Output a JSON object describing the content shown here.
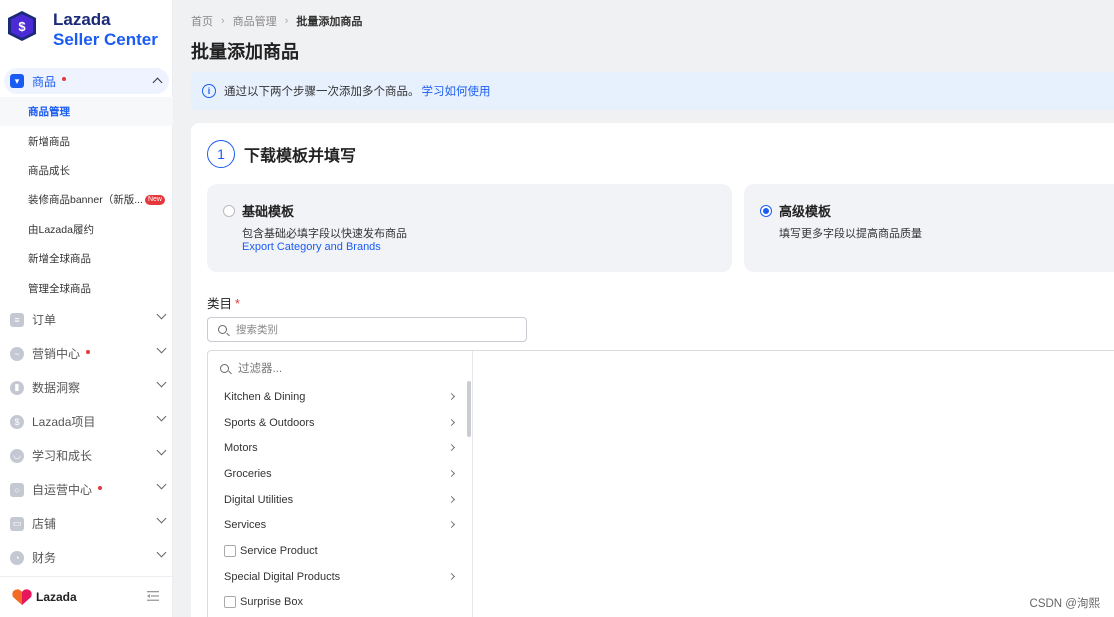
{
  "sidebar": {
    "logo": {
      "line1": "Lazada",
      "line2": "Seller Center"
    },
    "active_section": {
      "label": "商品"
    },
    "sub_items": [
      {
        "label": "商品管理"
      },
      {
        "label": "新增商品"
      },
      {
        "label": "商品成长"
      },
      {
        "label": "装修商品banner（新版...",
        "badge": "New"
      },
      {
        "label": "由Lazada履约"
      },
      {
        "label": "新增全球商品"
      },
      {
        "label": "管理全球商品"
      }
    ],
    "sections": [
      {
        "label": "订单",
        "dot": false
      },
      {
        "label": "营销中心",
        "dot": true
      },
      {
        "label": "数据洞察",
        "dot": false
      },
      {
        "label": "Lazada项目",
        "dot": false
      },
      {
        "label": "学习和成长",
        "dot": false
      },
      {
        "label": "自运营中心",
        "dot": true
      },
      {
        "label": "店铺",
        "dot": false
      },
      {
        "label": "财务",
        "dot": false
      }
    ],
    "footer_brand": "Lazada"
  },
  "breadcrumb": {
    "items": [
      "首页",
      "商品管理",
      "批量添加商品"
    ]
  },
  "page_title": "批量添加商品",
  "info": {
    "text": "通过以下两个步骤一次添加多个商品。",
    "link": "学习如何使用"
  },
  "step1": {
    "number": "1",
    "title": "下载模板并填写",
    "basic": {
      "title": "基础模板",
      "desc": "包含基础必填字段以快速发布商品",
      "link": "Export Category and Brands",
      "selected": false
    },
    "advanced": {
      "title": "高级模板",
      "desc": "填写更多字段以提高商品质量",
      "selected": true
    }
  },
  "category": {
    "label": "类目",
    "required_mark": "*",
    "search_placeholder": "搜索类别",
    "filter_placeholder": "过滤器...",
    "items": [
      {
        "label": "Kitchen & Dining",
        "type": "branch"
      },
      {
        "label": "Sports & Outdoors",
        "type": "branch"
      },
      {
        "label": "Motors",
        "type": "branch"
      },
      {
        "label": "Groceries",
        "type": "branch"
      },
      {
        "label": "Digital Utilities",
        "type": "branch"
      },
      {
        "label": "Services",
        "type": "branch"
      },
      {
        "label": "Service Product",
        "type": "checkbox"
      },
      {
        "label": "Special Digital Products",
        "type": "branch"
      },
      {
        "label": "Surprise Box",
        "type": "checkbox"
      }
    ]
  },
  "watermark": "CSDN @洵熙",
  "colors": {
    "brand_blue": "#1a5cf3",
    "required_red": "#e4393c"
  }
}
